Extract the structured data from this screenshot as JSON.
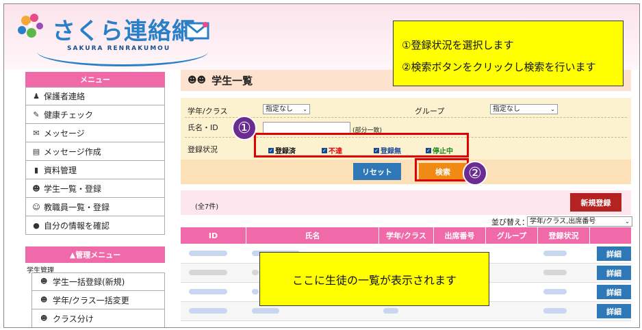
{
  "header": {
    "logo_title": "さくら連絡網",
    "logo_sub": "SAKURA RENRAKUMOU"
  },
  "notes": {
    "line1": "①登録状況を選択します",
    "line2": "②検索ボタンをクリックし検索を行います",
    "list_note": "ここに生徒の一覧が表示されます"
  },
  "sidebar": {
    "menu_title": "メニュー",
    "items": [
      {
        "label": "保護者連絡",
        "icon": "parent-contact-icon"
      },
      {
        "label": "健康チェック",
        "icon": "pen-icon"
      },
      {
        "label": "メッセージ",
        "icon": "envelope-icon"
      },
      {
        "label": "メッセージ作成",
        "icon": "compose-icon"
      },
      {
        "label": "資料管理",
        "icon": "books-icon"
      },
      {
        "label": "学生一覧・登録",
        "icon": "students-icon"
      },
      {
        "label": "教職員一覧・登録",
        "icon": "staff-icon"
      },
      {
        "label": "自分の情報を確認",
        "icon": "speech-bubble-icon"
      }
    ],
    "admin_title": "▲管理メニュー",
    "admin_group": "学生管理",
    "admin_items": [
      {
        "label": "学生一括登録(新規)"
      },
      {
        "label": "学年/クラス一括変更"
      },
      {
        "label": "クラス分け"
      }
    ]
  },
  "main": {
    "title": "学生一覧",
    "search": {
      "grade_label": "学年/クラス",
      "grade_value": "指定なし",
      "group_label": "グループ",
      "group_value": "指定なし",
      "name_label": "氏名・ID",
      "name_hint": "(部分一致)",
      "status_label": "登録状況",
      "statuses": [
        {
          "label": "登録済",
          "color": "#111111"
        },
        {
          "label": "不達",
          "color": "#e00000"
        },
        {
          "label": "登録無",
          "color": "#1a4a9a"
        },
        {
          "label": "停止中",
          "color": "#1a8a1a"
        }
      ],
      "reset_label": "リセット",
      "search_label": "検索"
    },
    "count": "(全7件)",
    "new_label": "新規登録",
    "sort_label": "並び替え：",
    "sort_value": "学年/クラス,出席番号",
    "columns": [
      "ID",
      "氏名",
      "学年/クラス",
      "出席番号",
      "グループ",
      "登録状況"
    ],
    "detail_label": "詳細",
    "callouts": [
      "①",
      "②"
    ]
  },
  "colors": {
    "pink": "#f06aa9",
    "red_button": "#b52222",
    "blue_button": "#2e78b8",
    "orange_button": "#f08a14"
  }
}
